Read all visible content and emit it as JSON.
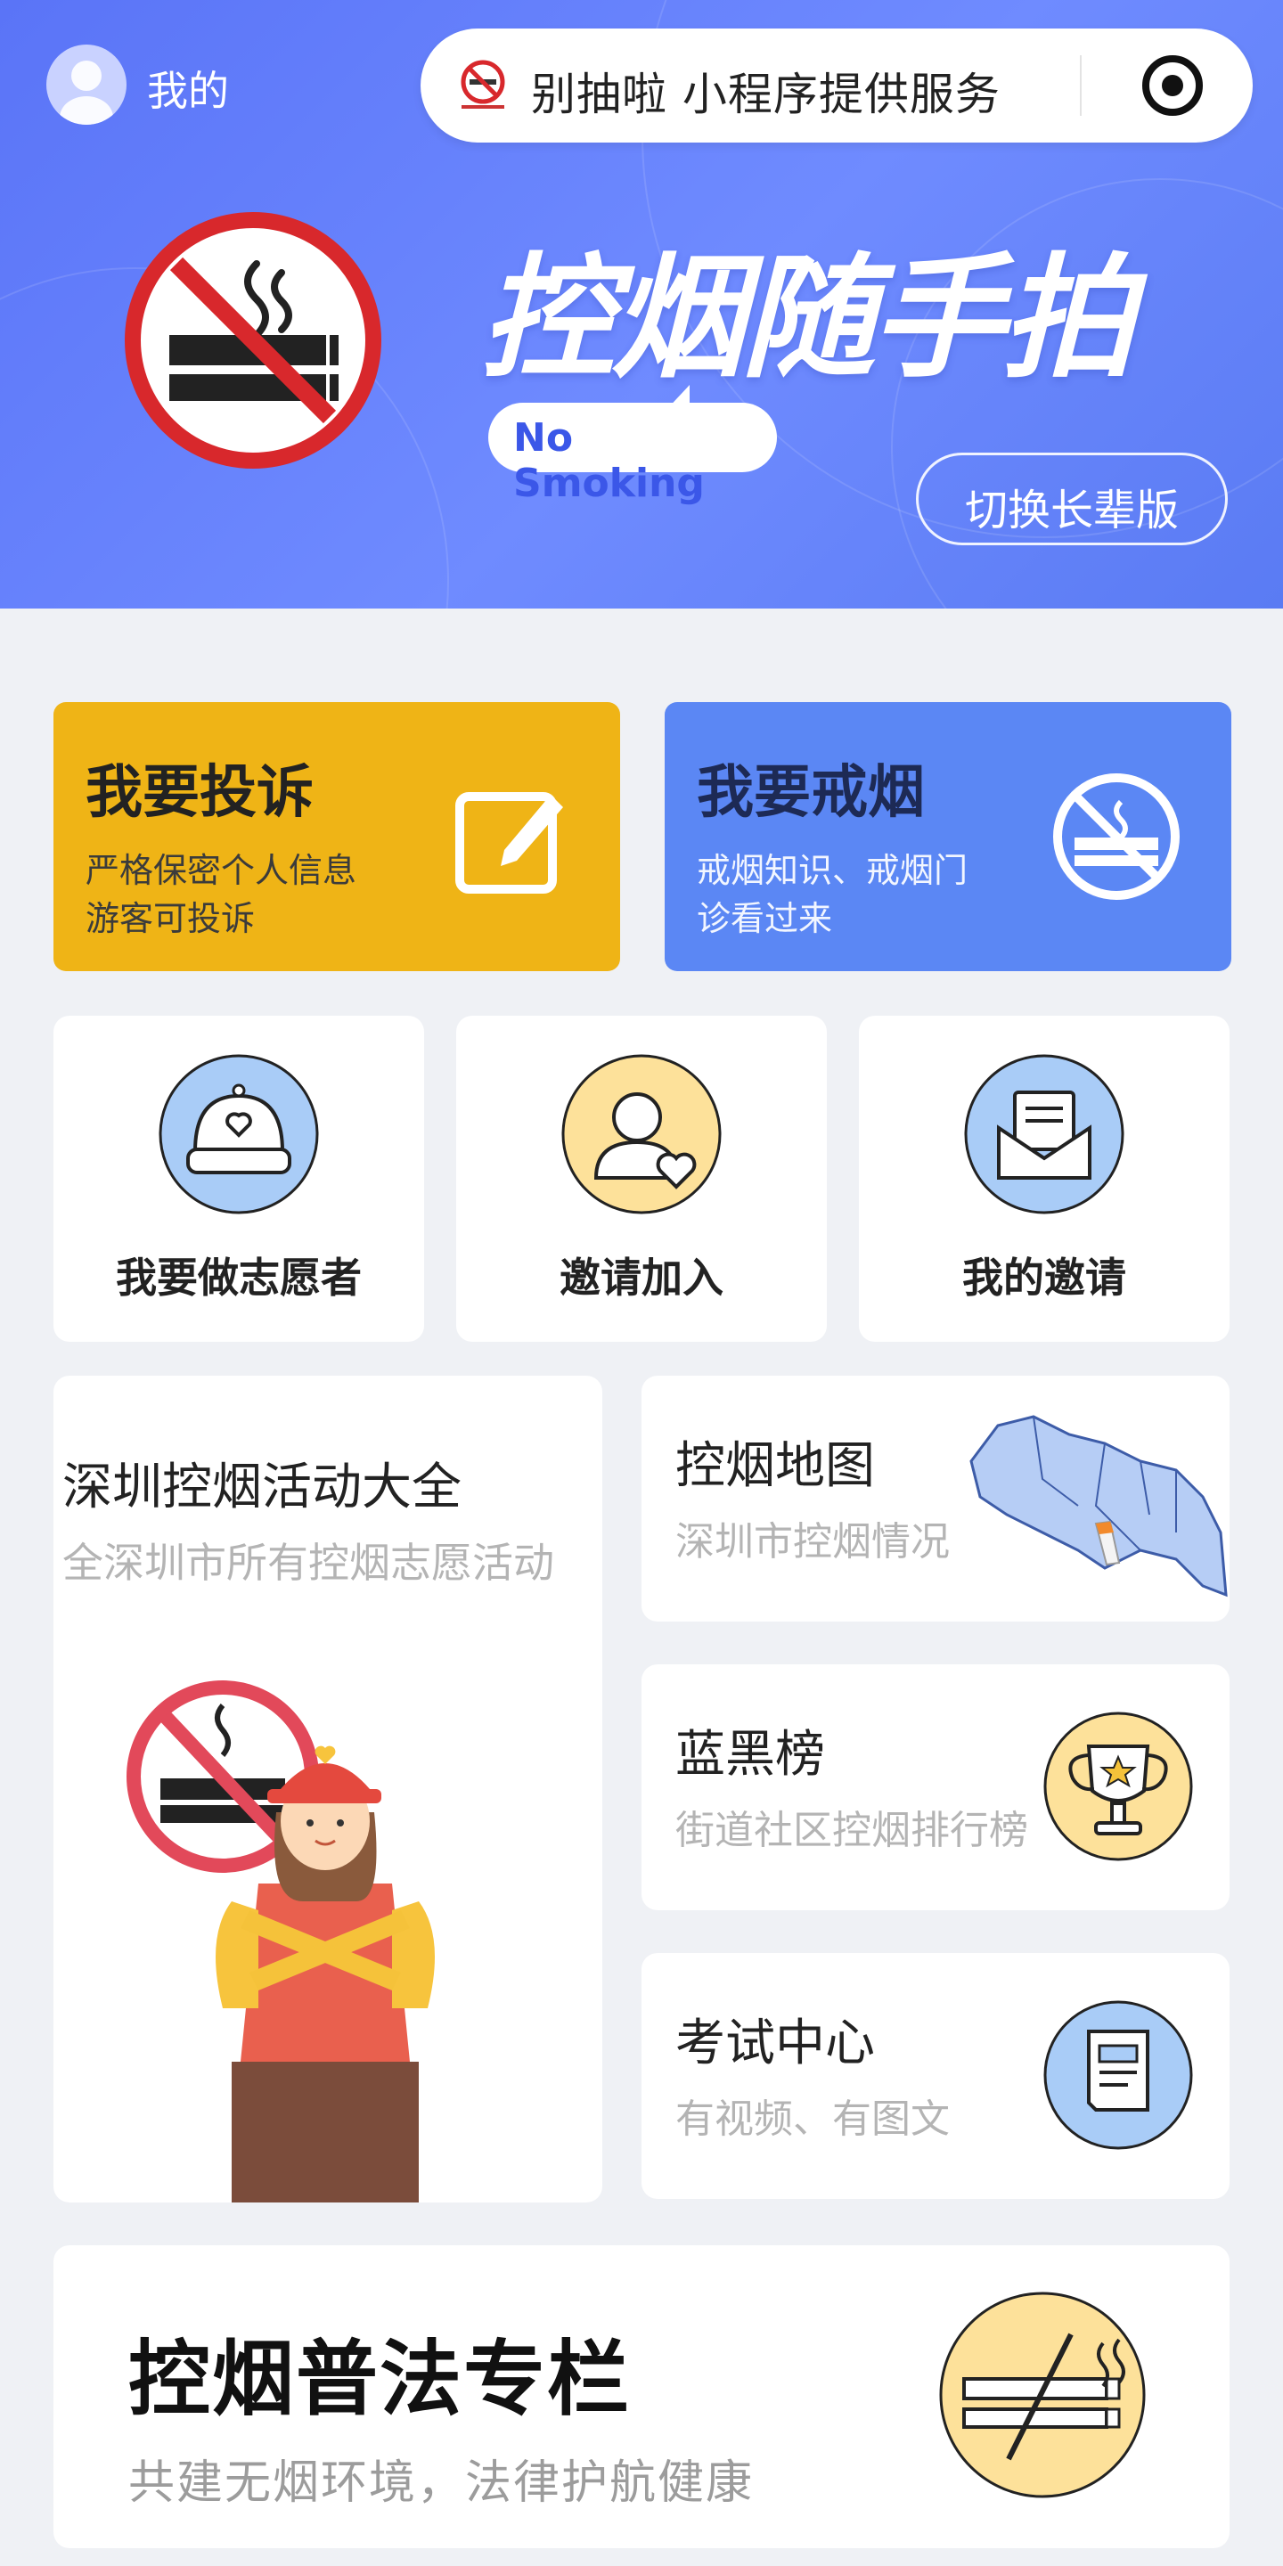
{
  "header": {
    "mine_label": "我的",
    "capsule_title": "别抽啦 小程序提供服务"
  },
  "hero": {
    "title": "控烟随手拍",
    "badge": "No Smoking",
    "switch_button": "切换长辈版"
  },
  "big_cards": [
    {
      "title": "我要投诉",
      "line1": "严格保密个人信息",
      "line2": "游客可投诉",
      "icon": "edit-icon",
      "color": "#efb416"
    },
    {
      "title": "我要戒烟",
      "line1": "戒烟知识、戒烟门",
      "line2": "诊看过来",
      "icon": "no-smoking-icon",
      "color": "#5b87f4"
    }
  ],
  "mid_cards": [
    {
      "label": "我要做志愿者",
      "icon": "volunteer-cap-icon"
    },
    {
      "label": "邀请加入",
      "icon": "invite-person-icon"
    },
    {
      "label": "我的邀请",
      "icon": "envelope-icon"
    }
  ],
  "activities": {
    "title": "深圳控烟活动大全",
    "subtitle": "全深圳市所有控烟志愿活动"
  },
  "side_cards": [
    {
      "title": "控烟地图",
      "subtitle": "深圳市控烟情况",
      "icon": "shenzhen-map-icon"
    },
    {
      "title": "蓝黑榜",
      "subtitle": "街道社区控烟排行榜",
      "icon": "trophy-icon"
    },
    {
      "title": "考试中心",
      "subtitle": "有视频、有图文",
      "icon": "exam-document-icon"
    }
  ],
  "law": {
    "title": "控烟普法专栏",
    "subtitle": "共建无烟环境，法律护航健康",
    "icon": "no-cigarette-icon"
  },
  "colors": {
    "hero_blue": "#5a74f7",
    "complain_yellow": "#efb416",
    "quit_blue": "#5b87f4",
    "icon_blue": "#a9ccf7",
    "icon_yellow": "#fde19a"
  }
}
